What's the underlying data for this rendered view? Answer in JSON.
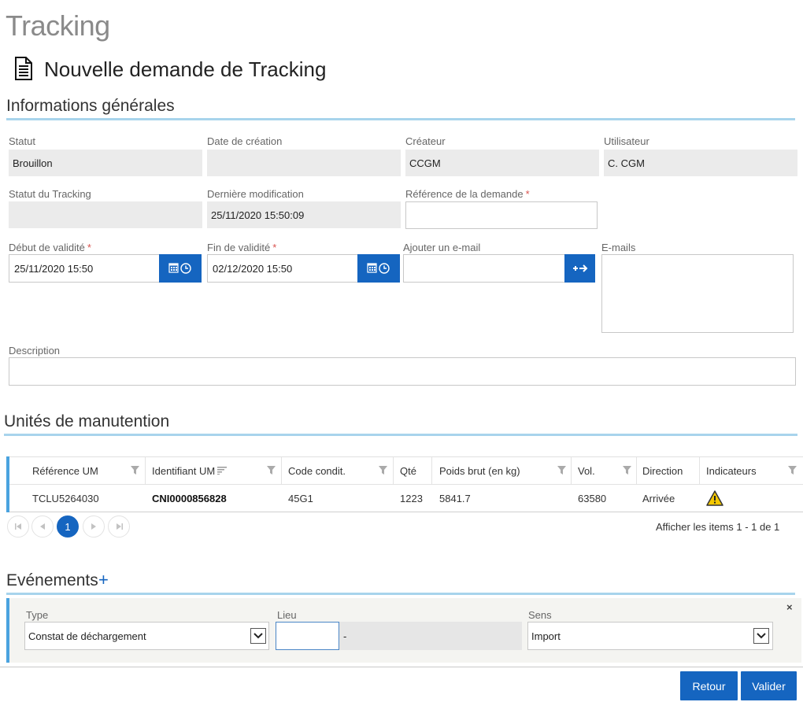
{
  "page": {
    "title": "Tracking"
  },
  "form": {
    "title": "Nouvelle demande de Tracking"
  },
  "general": {
    "section_title": "Informations générales",
    "statut_label": "Statut",
    "statut_value": "Brouillon",
    "date_creation_label": "Date de création",
    "date_creation_value": "",
    "createur_label": "Créateur",
    "createur_value": "CCGM",
    "utilisateur_label": "Utilisateur",
    "utilisateur_value": "C. CGM",
    "statut_tracking_label": "Statut du Tracking",
    "statut_tracking_value": "",
    "derniere_modif_label": "Dernière modification",
    "derniere_modif_value": "25/11/2020 15:50:09",
    "reference_label": "Référence de la demande",
    "reference_value": "",
    "debut_label": "Début de validité",
    "debut_value": "25/11/2020 15:50",
    "fin_label": "Fin de validité",
    "fin_value": "02/12/2020 15:50",
    "ajouter_email_label": "Ajouter un e-mail",
    "ajouter_email_value": "",
    "emails_label": "E-mails",
    "description_label": "Description",
    "description_value": "",
    "required_mark": "*"
  },
  "um": {
    "section_title": "Unités de manutention",
    "columns": [
      "Référence UM",
      "Identifiant UM",
      "Code condit.",
      "Qté",
      "Poids brut (en kg)",
      "Vol.",
      "Direction",
      "Indicateurs"
    ],
    "rows": [
      {
        "reference": "TCLU5264030",
        "identifiant": "CNI0000856828",
        "code": "45G1",
        "qte": "1223",
        "poids": "5841.7",
        "vol": "63580",
        "direction": "Arrivée",
        "indicator_icon": "warning-icon"
      }
    ],
    "pager": {
      "current_page": "1",
      "summary": "Afficher les items 1 - 1 de 1"
    }
  },
  "events": {
    "section_title": "Evénements",
    "add_symbol": "+",
    "close_symbol": "×",
    "type_label": "Type",
    "type_value": "Constat de déchargement",
    "lieu_label": "Lieu",
    "lieu_value": "",
    "lieu_desc": "-",
    "sens_label": "Sens",
    "sens_value": "Import"
  },
  "actions": {
    "retour_label": "Retour",
    "valider_label": "Valider"
  },
  "colors": {
    "accent": "#1565c0",
    "section_line": "#a8d4ec",
    "grid_accent": "#4aa3df",
    "readonly_bg": "#ebebeb",
    "warning": "#f5c800"
  }
}
